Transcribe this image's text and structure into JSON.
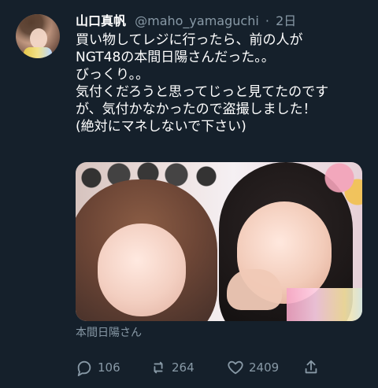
{
  "tweet": {
    "author_name": "山口真帆",
    "handle": "@maho_yamaguchi",
    "separator": "·",
    "time": "2日",
    "text_lines": [
      "買い物してレジに行ったら、前の人が",
      "NGT48の本間日陽さんだった。。",
      "びっくり。。",
      "気付くだろうと思ってじっと見てたのです",
      "が、気付かなかったので盗撮しました！",
      "(絶対にマネしないで下さい)"
    ],
    "media_caption": "本間日陽さん",
    "counts": {
      "replies": "106",
      "retweets": "264",
      "likes": "2409"
    }
  },
  "icons": {
    "reply": "reply-icon",
    "retweet": "retweet-icon",
    "like": "heart-icon",
    "share": "share-icon"
  },
  "colors": {
    "background": "#15202b",
    "primary_text": "#ffffff",
    "secondary_text": "#8899a6"
  }
}
